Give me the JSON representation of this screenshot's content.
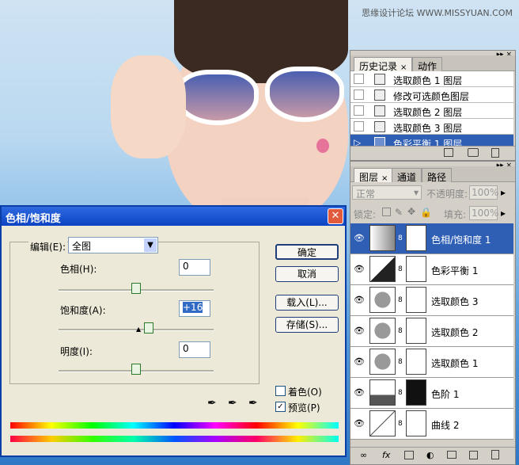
{
  "watermark": "思缘设计论坛 WWW.MISSYUAN.COM",
  "history_panel": {
    "tabs": [
      "历史记录",
      "动作"
    ],
    "items": [
      {
        "label": "选取颜色 1 图层",
        "selected": false
      },
      {
        "label": "修改可选颜色图层",
        "selected": false
      },
      {
        "label": "选取颜色 2 图层",
        "selected": false
      },
      {
        "label": "选取颜色 3 图层",
        "selected": false
      },
      {
        "label": "色彩平衡 1 图层",
        "selected": true
      }
    ]
  },
  "layers_panel": {
    "tabs": [
      "图层",
      "通道",
      "路径"
    ],
    "blend_mode": "正常",
    "opacity_label": "不透明度:",
    "opacity_value": "100%",
    "lock_label": "锁定:",
    "fill_label": "填充:",
    "fill_value": "100%",
    "layers": [
      {
        "name": "色相/饱和度 1",
        "selected": true
      },
      {
        "name": "色彩平衡 1",
        "selected": false
      },
      {
        "name": "选取颜色 3",
        "selected": false
      },
      {
        "name": "选取颜色 2",
        "selected": false
      },
      {
        "name": "选取颜色 1",
        "selected": false
      },
      {
        "name": "色阶 1",
        "selected": false
      },
      {
        "name": "曲线 2",
        "selected": false
      }
    ]
  },
  "dialog": {
    "title": "色相/饱和度",
    "edit_label": "编辑(E):",
    "edit_value": "全图",
    "hue_label": "色相(H):",
    "hue_value": "0",
    "saturation_label": "饱和度(A):",
    "saturation_value": "+16",
    "lightness_label": "明度(I):",
    "lightness_value": "0",
    "ok": "确定",
    "cancel": "取消",
    "load": "载入(L)...",
    "save": "存储(S)...",
    "colorize_label": "着色(O)",
    "colorize_checked": false,
    "preview_label": "预览(P)",
    "preview_checked": true,
    "icons": [
      "eyedropper-icon",
      "eyedropper-plus-icon",
      "eyedropper-minus-icon"
    ]
  }
}
